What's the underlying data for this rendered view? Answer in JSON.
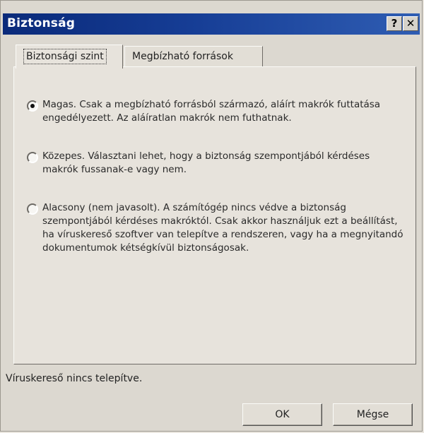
{
  "window": {
    "title": "Biztonság",
    "help_label": "?",
    "close_label": "✕"
  },
  "tabs": [
    {
      "label": "Biztonsági szint",
      "active": true
    },
    {
      "label": "Megbízható források",
      "active": false
    }
  ],
  "options": [
    {
      "label": "Magas. Csak a megbízható forrásból származó, aláírt makrók futtatása engedélyezett. Az aláíratlan makrók nem futhatnak.",
      "selected": true
    },
    {
      "label": "Közepes. Választani lehet, hogy a biztonság szempontjából kérdéses makrók fussanak-e vagy nem.",
      "selected": false
    },
    {
      "label": "Alacsony (nem javasolt). A számítógép nincs védve a biztonság szempontjából kérdéses makróktól. Csak akkor használjuk ezt a beállítást, ha víruskereső szoftver van telepítve a rendszeren, vagy ha a megnyitandó dokumentumok kétségkívül biztonságosak.",
      "selected": false
    }
  ],
  "status": "Víruskereső nincs telepítve.",
  "buttons": {
    "ok": "OK",
    "cancel": "Mégse"
  }
}
